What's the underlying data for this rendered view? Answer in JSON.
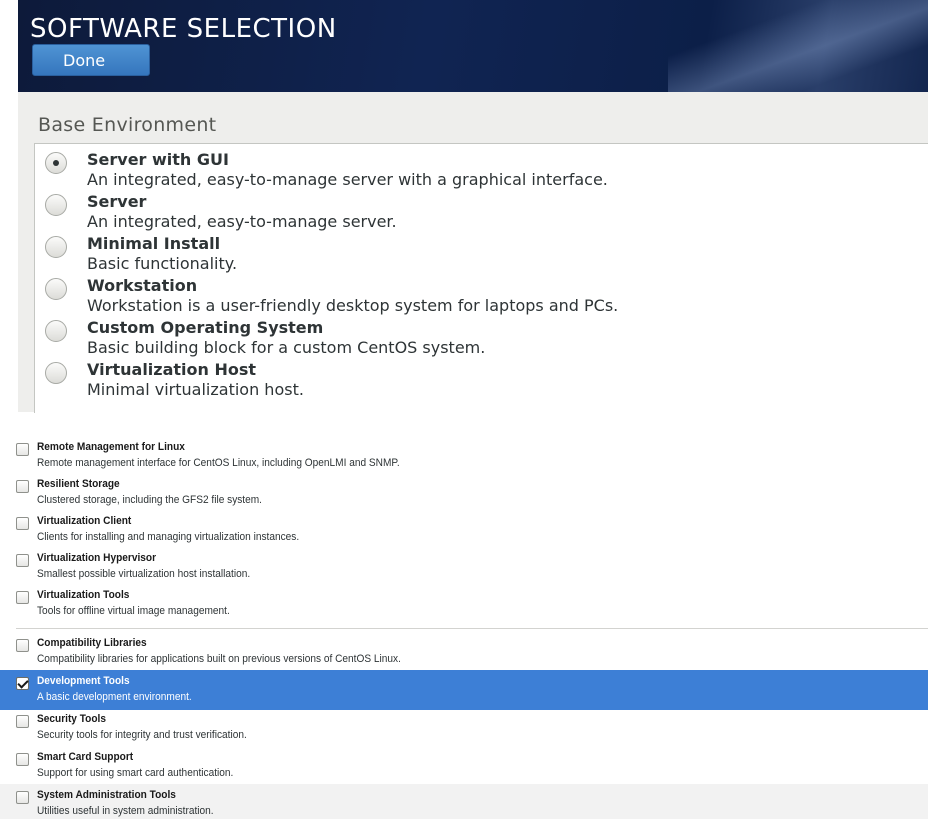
{
  "header": {
    "title": "SOFTWARE SELECTION",
    "done_label": "Done"
  },
  "base_environment": {
    "heading": "Base Environment",
    "selected": "Server with GUI",
    "options": [
      {
        "name": "Server with GUI",
        "description": "An integrated, easy-to-manage server with a graphical interface.",
        "selected": true
      },
      {
        "name": "Server",
        "description": "An integrated, easy-to-manage server.",
        "selected": false
      },
      {
        "name": "Minimal Install",
        "description": "Basic functionality.",
        "selected": false
      },
      {
        "name": "Workstation",
        "description": "Workstation is a user-friendly desktop system for laptops and PCs.",
        "selected": false
      },
      {
        "name": "Custom Operating System",
        "description": "Basic building block for a custom CentOS system.",
        "selected": false
      },
      {
        "name": "Virtualization Host",
        "description": "Minimal virtualization host.",
        "selected": false
      }
    ]
  },
  "addons": [
    {
      "name": "Remote Management for Linux",
      "description": "Remote management interface for CentOS Linux, including OpenLMI and SNMP.",
      "checked": false
    },
    {
      "name": "Resilient Storage",
      "description": "Clustered storage, including the GFS2 file system.",
      "checked": false
    },
    {
      "name": "Virtualization Client",
      "description": "Clients for installing and managing virtualization instances.",
      "checked": false
    },
    {
      "name": "Virtualization Hypervisor",
      "description": "Smallest possible virtualization host installation.",
      "checked": false
    },
    {
      "name": "Virtualization Tools",
      "description": "Tools for offline virtual image management.",
      "checked": false
    },
    {
      "name": "Compatibility Libraries",
      "description": "Compatibility libraries for applications built on previous versions of CentOS Linux.",
      "checked": false
    },
    {
      "name": "Development Tools",
      "description": "A basic development environment.",
      "checked": true
    },
    {
      "name": "Security Tools",
      "description": "Security tools for integrity and trust verification.",
      "checked": false
    },
    {
      "name": "Smart Card Support",
      "description": "Support for using smart card authentication.",
      "checked": false
    },
    {
      "name": "System Administration Tools",
      "description": "Utilities useful in system administration.",
      "checked": false
    }
  ],
  "colors": {
    "header_bg": "#102452",
    "done_button": "#3f83c8",
    "selected_row": "#3d7fd6",
    "env_area_bg": "#eeeeec"
  }
}
